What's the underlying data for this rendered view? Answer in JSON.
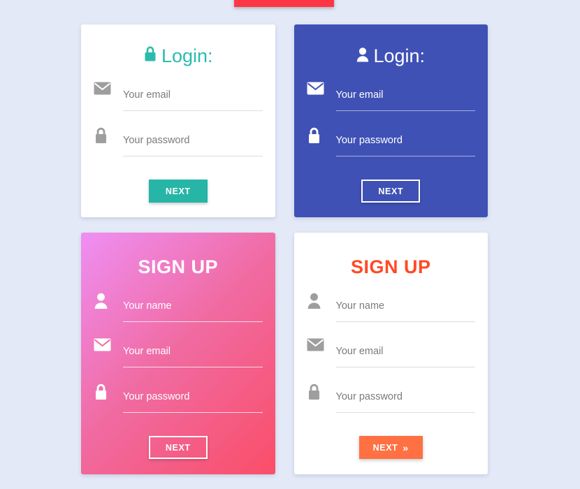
{
  "page": {
    "background_color": "#E3E9F7"
  },
  "top_bar": {
    "name": "partial-red-bar",
    "color": "#FD3646"
  },
  "cards": [
    {
      "id": "login-teal",
      "title": "Login:",
      "title_icon": "lock-icon",
      "title_color": "#2BBBAD",
      "background": "#FFFFFF",
      "fields": [
        {
          "icon": "envelope-icon",
          "placeholder": "Your email",
          "value": ""
        },
        {
          "icon": "lock-icon",
          "placeholder": "Your password",
          "value": ""
        }
      ],
      "button": {
        "label": "NEXT",
        "style": "filled-teal",
        "color": "#26B5A6",
        "chevron": ""
      }
    },
    {
      "id": "login-indigo",
      "title": "Login:",
      "title_icon": "person-icon",
      "title_color": "#FFFFFF",
      "background": "#3F51B5",
      "fields": [
        {
          "icon": "envelope-icon",
          "placeholder": "Your email",
          "value": ""
        },
        {
          "icon": "lock-icon",
          "placeholder": "Your password",
          "value": ""
        }
      ],
      "button": {
        "label": "NEXT",
        "style": "outline-white",
        "color": "#FFFFFF",
        "chevron": ""
      }
    },
    {
      "id": "signup-pink",
      "title": "SIGN UP",
      "title_icon": "",
      "title_color": "#FFFFFF",
      "background": "linear-gradient #EF8FF4 to #FA4E68",
      "fields": [
        {
          "icon": "person-icon",
          "placeholder": "Your name",
          "value": ""
        },
        {
          "icon": "envelope-icon",
          "placeholder": "Your email",
          "value": ""
        },
        {
          "icon": "lock-icon",
          "placeholder": "Your password",
          "value": ""
        }
      ],
      "button": {
        "label": "NEXT",
        "style": "outline-white",
        "color": "#FFFFFF",
        "chevron": ""
      }
    },
    {
      "id": "signup-white",
      "title": "SIGN UP",
      "title_icon": "",
      "title_color": "#FF4A24",
      "background": "#FFFFFF",
      "fields": [
        {
          "icon": "person-icon",
          "placeholder": "Your name",
          "value": ""
        },
        {
          "icon": "envelope-icon",
          "placeholder": "Your email",
          "value": ""
        },
        {
          "icon": "lock-icon",
          "placeholder": "Your password",
          "value": ""
        }
      ],
      "button": {
        "label": "NEXT",
        "style": "filled-orange",
        "color": "#FF7043",
        "chevron": "»"
      }
    }
  ]
}
